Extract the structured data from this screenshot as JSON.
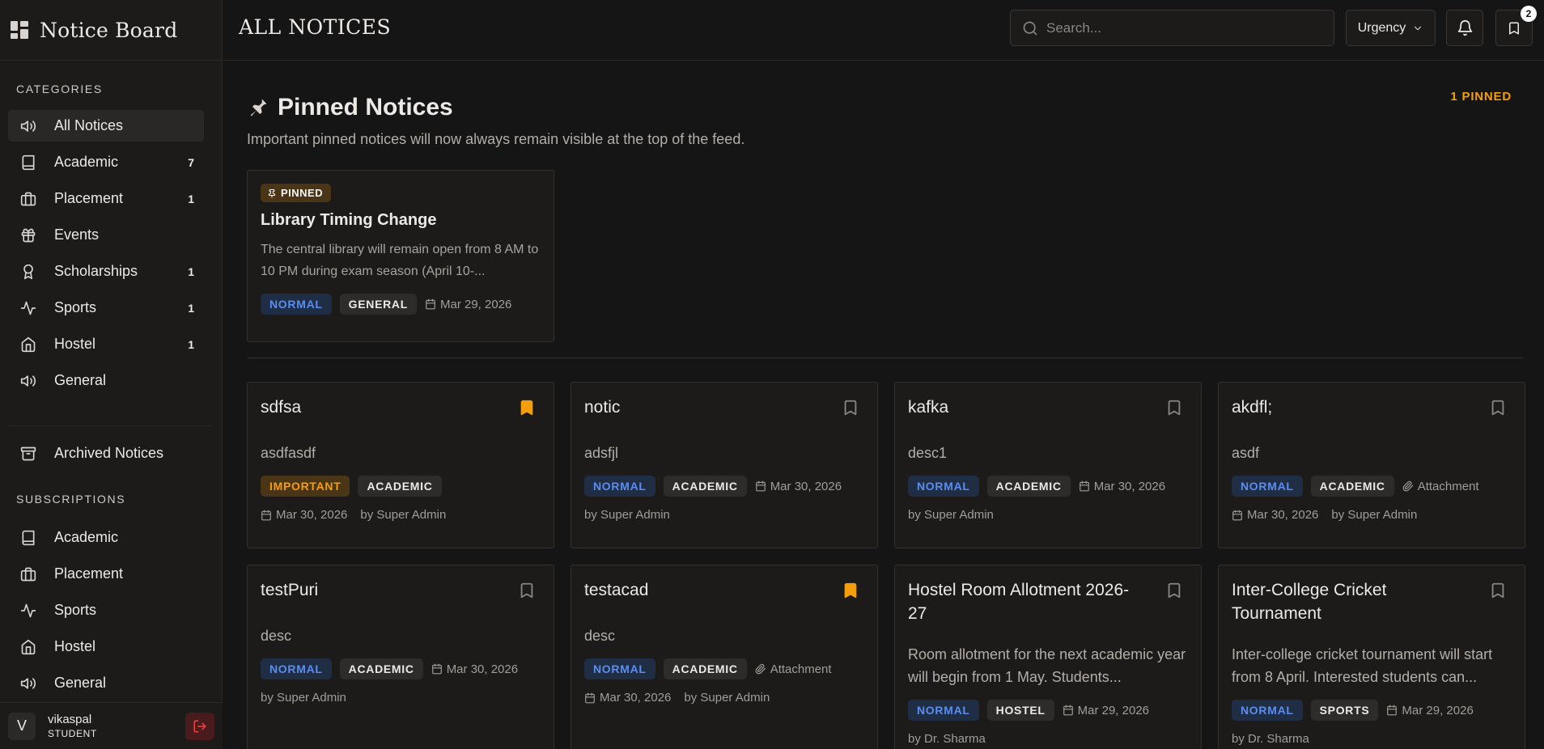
{
  "app": {
    "title": "Notice Board"
  },
  "header": {
    "page_title": "ALL NOTICES",
    "search_placeholder": "Search...",
    "urgency_label": "Urgency",
    "bookmark_badge": "2"
  },
  "sidebar": {
    "categories_label": "CATEGORIES",
    "categories": [
      {
        "label": "All Notices",
        "count": "",
        "icon": "megaphone-icon"
      },
      {
        "label": "Academic",
        "count": "7",
        "icon": "book-icon"
      },
      {
        "label": "Placement",
        "count": "1",
        "icon": "briefcase-icon"
      },
      {
        "label": "Events",
        "count": "",
        "icon": "gift-icon"
      },
      {
        "label": "Scholarships",
        "count": "1",
        "icon": "award-icon"
      },
      {
        "label": "Sports",
        "count": "1",
        "icon": "activity-icon"
      },
      {
        "label": "Hostel",
        "count": "1",
        "icon": "home-icon"
      },
      {
        "label": "General",
        "count": "",
        "icon": "megaphone-icon"
      }
    ],
    "archived_label": "Archived Notices",
    "subscriptions_label": "SUBSCRIPTIONS",
    "subscriptions": [
      {
        "label": "Academic",
        "icon": "book-icon"
      },
      {
        "label": "Placement",
        "icon": "briefcase-icon"
      },
      {
        "label": "Sports",
        "icon": "activity-icon"
      },
      {
        "label": "Hostel",
        "icon": "home-icon"
      },
      {
        "label": "General",
        "icon": "megaphone-icon"
      }
    ],
    "user": {
      "initial": "V",
      "name": "vikaspal",
      "role": "STUDENT"
    }
  },
  "pinned": {
    "title": "Pinned Notices",
    "count_label": "1 PINNED",
    "description": "Important pinned notices will now always remain visible at the top of the feed.",
    "card": {
      "badge": "PINNED",
      "title": "Library Timing Change",
      "body": "The central library will remain open from 8 AM to 10 PM during exam season (April 10-...",
      "urgency": "NORMAL",
      "category": "GENERAL",
      "date": "Mar 29, 2026"
    }
  },
  "notices": [
    {
      "title": "sdfsa",
      "desc": "asdfasdf",
      "urgency": "IMPORTANT",
      "category": "ACADEMIC",
      "inline_meta": "",
      "foot_date": "Mar 30, 2026",
      "author": "by Super Admin",
      "bookmarked": true
    },
    {
      "title": "notic",
      "desc": "adsfjl",
      "urgency": "NORMAL",
      "category": "ACADEMIC",
      "inline_meta": "Mar 30, 2026",
      "foot_date": "",
      "author": "by Super Admin",
      "bookmarked": false
    },
    {
      "title": "kafka",
      "desc": "desc1",
      "urgency": "NORMAL",
      "category": "ACADEMIC",
      "inline_meta": "Mar 30, 2026",
      "foot_date": "",
      "author": "by Super Admin",
      "bookmarked": false
    },
    {
      "title": "akdfl;",
      "desc": "asdf",
      "urgency": "NORMAL",
      "category": "ACADEMIC",
      "inline_meta": "Attachment",
      "foot_date": "Mar 30, 2026",
      "author": "by Super Admin",
      "bookmarked": false
    },
    {
      "title": "testPuri",
      "desc": "desc",
      "urgency": "NORMAL",
      "category": "ACADEMIC",
      "inline_meta": "Mar 30, 2026",
      "foot_date": "",
      "author": "by Super Admin",
      "bookmarked": false
    },
    {
      "title": "testacad",
      "desc": "desc",
      "urgency": "NORMAL",
      "category": "ACADEMIC",
      "inline_meta": "Attachment",
      "foot_date": "Mar 30, 2026",
      "author": "by Super Admin",
      "bookmarked": true
    },
    {
      "title": "Hostel Room Allotment 2026-27",
      "desc": "Room allotment for the next academic year will begin from 1 May. Students...",
      "urgency": "NORMAL",
      "category": "HOSTEL",
      "inline_meta": "Mar 29, 2026",
      "foot_date": "",
      "author": "by Dr. Sharma",
      "bookmarked": false
    },
    {
      "title": "Inter-College Cricket Tournament",
      "desc": "Inter-college cricket tournament will start from 8 April. Interested students can...",
      "urgency": "NORMAL",
      "category": "SPORTS",
      "inline_meta": "Mar 29, 2026",
      "foot_date": "",
      "author": "by Dr. Sharma",
      "bookmarked": false
    }
  ],
  "colors": {
    "accent": "#f59e0b",
    "normal": "#5b8def",
    "background": "#161515",
    "card": "#1c1b1a"
  }
}
